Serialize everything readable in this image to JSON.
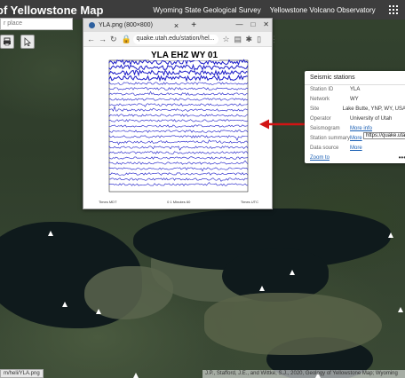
{
  "header": {
    "title": "of Yellowstone Map",
    "links": [
      "Wyoming State Geological Survey",
      "Yellowstone Volcano Observatory"
    ]
  },
  "search": {
    "placeholder": "r place"
  },
  "browser": {
    "tab_title": "YLA.png (800×800)",
    "url": "quake.utah.edu/station/hel...",
    "window_buttons": [
      "—",
      "□",
      "✕"
    ]
  },
  "seismogram": {
    "title": "YLA EHZ WY 01",
    "footer_left": "Times MDT",
    "footer_mid": "0  1 Minutes  60",
    "footer_right": "Times UTC"
  },
  "popup": {
    "title": "Seismic stations",
    "rows": [
      {
        "key": "Station ID",
        "value": "YLA",
        "link": false
      },
      {
        "key": "Network",
        "value": "WY",
        "link": false
      },
      {
        "key": "Site",
        "value": "Lake Butte, YNP, WY, USA",
        "link": false
      },
      {
        "key": "Operator",
        "value": "University of Utah",
        "link": false
      },
      {
        "key": "Seismogram",
        "value": "More info",
        "link": true
      },
      {
        "key": "Station summary",
        "value": "More",
        "link": true
      },
      {
        "key": "Data source",
        "value": "More",
        "link": true
      }
    ],
    "tooltip": "https://quake.utah",
    "zoom_label": "Zoom to",
    "more_label": "•••"
  },
  "status_url": "m/heli/YLA.png",
  "attribution": "J.P., Stafford, J.E., and Wittke, S.J., 2020, Geology of Yellowstone Map; Wyoming",
  "colors": {
    "header_bg": "#3d3d3d",
    "trace_blue": "#1c1cc8",
    "arrow_red": "#d21414",
    "link_blue": "#1a5fb4"
  }
}
